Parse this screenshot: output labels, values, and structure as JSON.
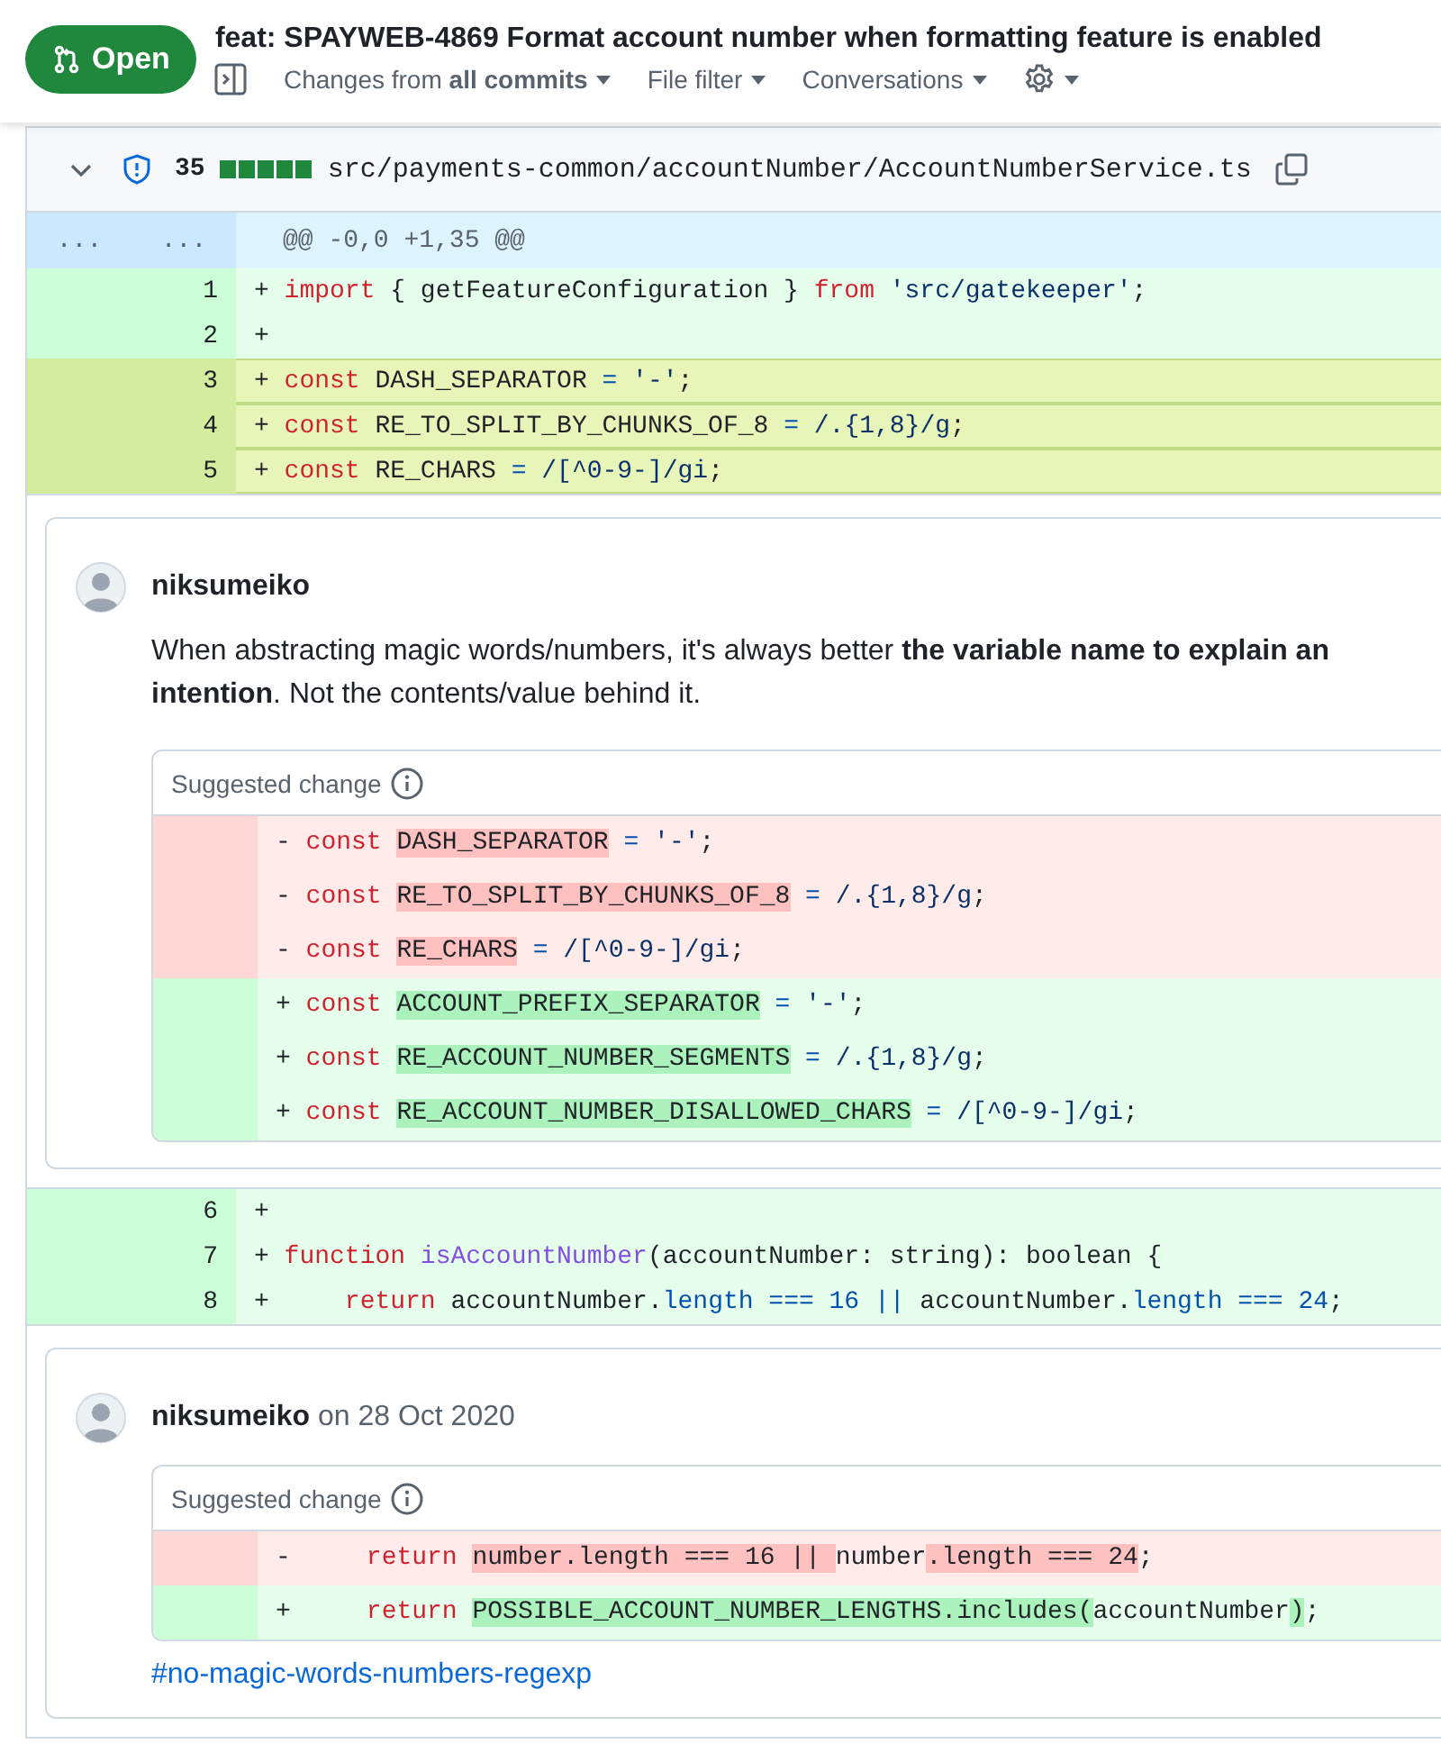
{
  "header": {
    "state": "Open",
    "title": "feat: SPAYWEB-4869 Format account number when formatting feature is enabled",
    "toolbar": [
      {
        "label": "Changes from **all commits**"
      },
      {
        "label": "File filter"
      },
      {
        "label": "Conversations"
      }
    ]
  },
  "file": {
    "expanded": true,
    "additions": "35",
    "path": "src/payments-common/accountNumber/AccountNumberService.ts",
    "items": [
      {
        "kind": "hunk",
        "old_number": "...",
        "new_number": "...",
        "text": "@@ -0,0 +1,35 @@"
      },
      {
        "kind": "line",
        "number": "1",
        "sign": "+",
        "selected": false,
        "tokens": [
          {
            "text": " import",
            "kind": "keyword"
          },
          {
            "text": " { getFeatureConfiguration } ",
            "kind": "plain"
          },
          {
            "text": "from",
            "kind": "keyword"
          },
          {
            "text": " 'src/gatekeeper'",
            "kind": "string"
          },
          {
            "text": ";",
            "kind": "plain"
          }
        ]
      },
      {
        "kind": "line",
        "number": "2",
        "sign": "+",
        "selected": false
      },
      {
        "kind": "line",
        "number": "3",
        "sign": "+",
        "selected": true,
        "tokens": [
          {
            "text": " const",
            "kind": "keyword"
          },
          {
            "text": " DASH_SEPARATOR ",
            "kind": "plain"
          },
          {
            "text": "=",
            "kind": "constant"
          },
          {
            "text": " '-'",
            "kind": "string"
          },
          {
            "text": ";",
            "kind": "plain"
          }
        ]
      },
      {
        "kind": "line",
        "number": "4",
        "sign": "+",
        "selected": true,
        "tokens": [
          {
            "text": " const",
            "kind": "keyword"
          },
          {
            "text": " RE_TO_SPLIT_BY_CHUNKS_OF_8 ",
            "kind": "plain"
          },
          {
            "text": "=",
            "kind": "constant"
          },
          {
            "text": " /.{1,8}/g",
            "kind": "string"
          },
          {
            "text": ";",
            "kind": "plain"
          }
        ]
      },
      {
        "kind": "line",
        "number": "5",
        "sign": "+",
        "selected": true,
        "tokens": [
          {
            "text": " const",
            "kind": "keyword"
          },
          {
            "text": " RE_CHARS ",
            "kind": "plain"
          },
          {
            "text": "=",
            "kind": "constant"
          },
          {
            "text": " /[^0-9-]/gi",
            "kind": "string"
          },
          {
            "text": ";",
            "kind": "plain"
          }
        ]
      },
      {
        "kind": "comment",
        "author": "niksumeiko",
        "body": "When abstracting magic words/numbers, it's always better **the variable name to explain an intention**.  Not the contents/value behind it.",
        "suggestion": {
          "title": "Suggested change",
          "lines": [
            {
              "kind": "deletion",
              "sign": "-",
              "tokens": [
                {
                  "text": " const ",
                  "kind": "keyword"
                },
                {
                  "text": "DASH_SEPARATOR",
                  "kind": "changed"
                },
                {
                  "text": " =",
                  "kind": "constant"
                },
                {
                  "text": " '-'",
                  "kind": "string"
                },
                {
                  "text": ";",
                  "kind": "plain"
                }
              ]
            },
            {
              "kind": "deletion",
              "sign": "-",
              "tokens": [
                {
                  "text": " const ",
                  "kind": "keyword"
                },
                {
                  "text": "RE_TO_SPLIT_BY_CHUNKS_OF_8",
                  "kind": "changed"
                },
                {
                  "text": " =",
                  "kind": "constant"
                },
                {
                  "text": " /.{1,8}/g",
                  "kind": "string"
                },
                {
                  "text": ";",
                  "kind": "plain"
                }
              ]
            },
            {
              "kind": "deletion",
              "sign": "-",
              "tokens": [
                {
                  "text": " const ",
                  "kind": "keyword"
                },
                {
                  "text": "RE_CHARS",
                  "kind": "changed"
                },
                {
                  "text": " =",
                  "kind": "constant"
                },
                {
                  "text": " /[^0-9-]/gi",
                  "kind": "string"
                },
                {
                  "text": ";",
                  "kind": "plain"
                }
              ]
            },
            {
              "kind": "addition",
              "sign": "+",
              "tokens": [
                {
                  "text": " const ",
                  "kind": "keyword"
                },
                {
                  "text": "ACCOUNT_PREFIX_SEPARATOR",
                  "kind": "changed"
                },
                {
                  "text": " =",
                  "kind": "constant"
                },
                {
                  "text": " '-'",
                  "kind": "string"
                },
                {
                  "text": ";",
                  "kind": "plain"
                }
              ]
            },
            {
              "kind": "addition",
              "sign": "+",
              "tokens": [
                {
                  "text": " const ",
                  "kind": "keyword"
                },
                {
                  "text": "RE_ACCOUNT_NUMBER_SEGMENTS",
                  "kind": "changed"
                },
                {
                  "text": " =",
                  "kind": "constant"
                },
                {
                  "text": " /.{1,8}/g",
                  "kind": "string"
                },
                {
                  "text": ";",
                  "kind": "plain"
                }
              ]
            },
            {
              "kind": "addition",
              "sign": "+",
              "tokens": [
                {
                  "text": " const ",
                  "kind": "keyword"
                },
                {
                  "text": "RE_ACCOUNT_NUMBER_DISALLOWED_CHARS",
                  "kind": "changed"
                },
                {
                  "text": " =",
                  "kind": "constant"
                },
                {
                  "text": " /[^0-9-]/gi",
                  "kind": "string"
                },
                {
                  "text": ";",
                  "kind": "plain"
                }
              ]
            }
          ]
        }
      },
      {
        "kind": "line",
        "number": "6",
        "sign": "+",
        "selected": false
      },
      {
        "kind": "line",
        "number": "7",
        "sign": "+",
        "selected": false,
        "tokens": [
          {
            "text": " function ",
            "kind": "keyword"
          },
          {
            "text": "isAccountNumber",
            "kind": "function"
          },
          {
            "text": "(accountNumber: string): boolean {",
            "kind": "plain"
          }
        ]
      },
      {
        "kind": "line",
        "number": "8",
        "sign": "+",
        "selected": false,
        "tokens": [
          {
            "text": "     return",
            "kind": "keyword"
          },
          {
            "text": " accountNumber.",
            "kind": "plain"
          },
          {
            "text": "length === 16 ||",
            "kind": "constant"
          },
          {
            "text": " accountNumber.",
            "kind": "plain"
          },
          {
            "text": "length === 24",
            "kind": "constant"
          },
          {
            "text": ";",
            "kind": "plain"
          }
        ]
      },
      {
        "kind": "comment",
        "author": "niksumeiko",
        "date": "on 28 Oct 2020",
        "suggestion": {
          "title": "Suggested change",
          "lines": [
            {
              "kind": "deletion",
              "sign": "-",
              "tokens": [
                {
                  "text": "     return ",
                  "kind": "keyword"
                },
                {
                  "text": "number.length === 16 || ",
                  "kind": "changed"
                },
                {
                  "text": "number",
                  "kind": "plain"
                },
                {
                  "text": ".length === 24",
                  "kind": "changed"
                },
                {
                  "text": ";",
                  "kind": "plain"
                }
              ]
            },
            {
              "kind": "addition",
              "sign": "+",
              "tokens": [
                {
                  "text": "     return ",
                  "kind": "keyword"
                },
                {
                  "text": "POSSIBLE_ACCOUNT_NUMBER_LENGTHS.includes(",
                  "kind": "changed"
                },
                {
                  "text": "accountNumber",
                  "kind": "plain"
                },
                {
                  "text": ")",
                  "kind": "changed"
                },
                {
                  "text": ";",
                  "kind": "plain"
                }
              ]
            }
          ]
        },
        "link": "#no-magic-words-numbers-regexp"
      }
    ]
  }
}
